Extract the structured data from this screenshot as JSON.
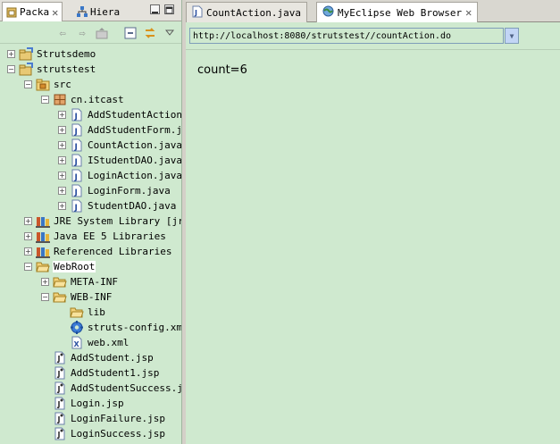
{
  "left_view": {
    "tabs": [
      {
        "label": "Packa",
        "icon": "package-explorer-icon",
        "active": true
      },
      {
        "label": "Hiera",
        "icon": "hierarchy-icon",
        "active": false
      }
    ],
    "tree": [
      {
        "label": "Strutsdemo",
        "indent": 0,
        "toggle": "+",
        "icon": "project-icon"
      },
      {
        "label": "strutstest",
        "indent": 0,
        "toggle": "-",
        "icon": "project-icon"
      },
      {
        "label": "src",
        "indent": 1,
        "toggle": "-",
        "icon": "source-folder-icon"
      },
      {
        "label": "cn.itcast",
        "indent": 2,
        "toggle": "-",
        "icon": "package-icon"
      },
      {
        "label": "AddStudentAction.java",
        "indent": 3,
        "toggle": "+",
        "icon": "java-file-icon"
      },
      {
        "label": "AddStudentForm.java",
        "indent": 3,
        "toggle": "+",
        "icon": "java-file-icon"
      },
      {
        "label": "CountAction.java",
        "indent": 3,
        "toggle": "+",
        "icon": "java-file-icon"
      },
      {
        "label": "IStudentDAO.java",
        "indent": 3,
        "toggle": "+",
        "icon": "java-file-icon"
      },
      {
        "label": "LoginAction.java",
        "indent": 3,
        "toggle": "+",
        "icon": "java-file-icon"
      },
      {
        "label": "LoginForm.java",
        "indent": 3,
        "toggle": "+",
        "icon": "java-file-icon"
      },
      {
        "label": "StudentDAO.java",
        "indent": 3,
        "toggle": "+",
        "icon": "java-file-icon"
      },
      {
        "label": "JRE System Library [jre]",
        "indent": 1,
        "toggle": "+",
        "icon": "library-icon"
      },
      {
        "label": "Java EE 5 Libraries",
        "indent": 1,
        "toggle": "+",
        "icon": "library-icon"
      },
      {
        "label": "Referenced Libraries",
        "indent": 1,
        "toggle": "+",
        "icon": "library-icon"
      },
      {
        "label": "WebRoot",
        "indent": 1,
        "toggle": "-",
        "icon": "folder-open-icon",
        "selected": true
      },
      {
        "label": "META-INF",
        "indent": 2,
        "toggle": "+",
        "icon": "folder-open-icon"
      },
      {
        "label": "WEB-INF",
        "indent": 2,
        "toggle": "-",
        "icon": "folder-open-icon"
      },
      {
        "label": "lib",
        "indent": 3,
        "toggle": "",
        "icon": "folder-open-icon"
      },
      {
        "label": "struts-config.xml",
        "indent": 3,
        "toggle": "",
        "icon": "gear-icon"
      },
      {
        "label": "web.xml",
        "indent": 3,
        "toggle": "",
        "icon": "xml-file-icon"
      },
      {
        "label": "AddStudent.jsp",
        "indent": 2,
        "toggle": "",
        "icon": "jsp-file-icon"
      },
      {
        "label": "AddStudent1.jsp",
        "indent": 2,
        "toggle": "",
        "icon": "jsp-file-icon"
      },
      {
        "label": "AddStudentSuccess.jsp",
        "indent": 2,
        "toggle": "",
        "icon": "jsp-file-icon"
      },
      {
        "label": "Login.jsp",
        "indent": 2,
        "toggle": "",
        "icon": "jsp-file-icon"
      },
      {
        "label": "LoginFailure.jsp",
        "indent": 2,
        "toggle": "",
        "icon": "jsp-file-icon"
      },
      {
        "label": "LoginSuccess.jsp",
        "indent": 2,
        "toggle": "",
        "icon": "jsp-file-icon"
      }
    ]
  },
  "editor": {
    "tabs": [
      {
        "label": "CountAction.java",
        "icon": "java-file-icon",
        "active": false
      },
      {
        "label": "MyEclipse Web Browser",
        "icon": "globe-icon",
        "active": true
      }
    ],
    "url": "http://localhost:8080/strutstest//countAction.do",
    "page_text": "count=6"
  },
  "colors": {
    "background": "#cfe9cf",
    "selection": "#ffffff"
  }
}
